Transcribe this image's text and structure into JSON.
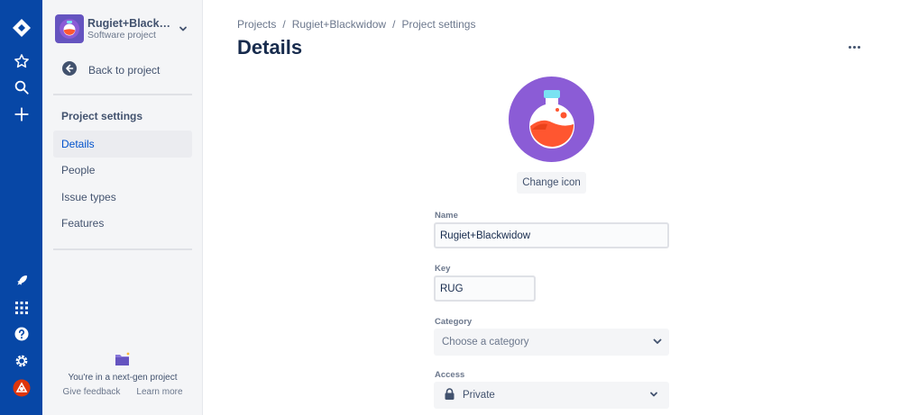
{
  "sidebar": {
    "project_name": "Rugiet+Blackwidow",
    "project_type": "Software project",
    "back_label": "Back to project",
    "section_title": "Project settings",
    "items": [
      {
        "label": "Details"
      },
      {
        "label": "People"
      },
      {
        "label": "Issue types"
      },
      {
        "label": "Features"
      }
    ],
    "footer_text": "You're in a next-gen project",
    "feedback_label": "Give feedback",
    "learn_more_label": "Learn more"
  },
  "breadcrumb": {
    "items": [
      "Projects",
      "Rugiet+Blackwidow",
      "Project settings"
    ],
    "separator": "/"
  },
  "page": {
    "title": "Details",
    "change_icon_label": "Change icon"
  },
  "form": {
    "name_label": "Name",
    "name_value": "Rugiet+Blackwidow",
    "key_label": "Key",
    "key_value": "RUG",
    "category_label": "Category",
    "category_placeholder": "Choose a category",
    "access_label": "Access",
    "access_value": "Private"
  },
  "icons": {
    "rail": [
      "jira-logo-icon",
      "star-icon",
      "search-icon",
      "plus-icon",
      "rocket-icon",
      "apps-grid-icon",
      "help-icon",
      "settings-icon",
      "user-avatar"
    ],
    "project_avatar": "potion-icon"
  },
  "colors": {
    "rail_bg": "#0747a6",
    "accent": "#0052cc",
    "project_icon_bg": "#8b5cd6"
  }
}
